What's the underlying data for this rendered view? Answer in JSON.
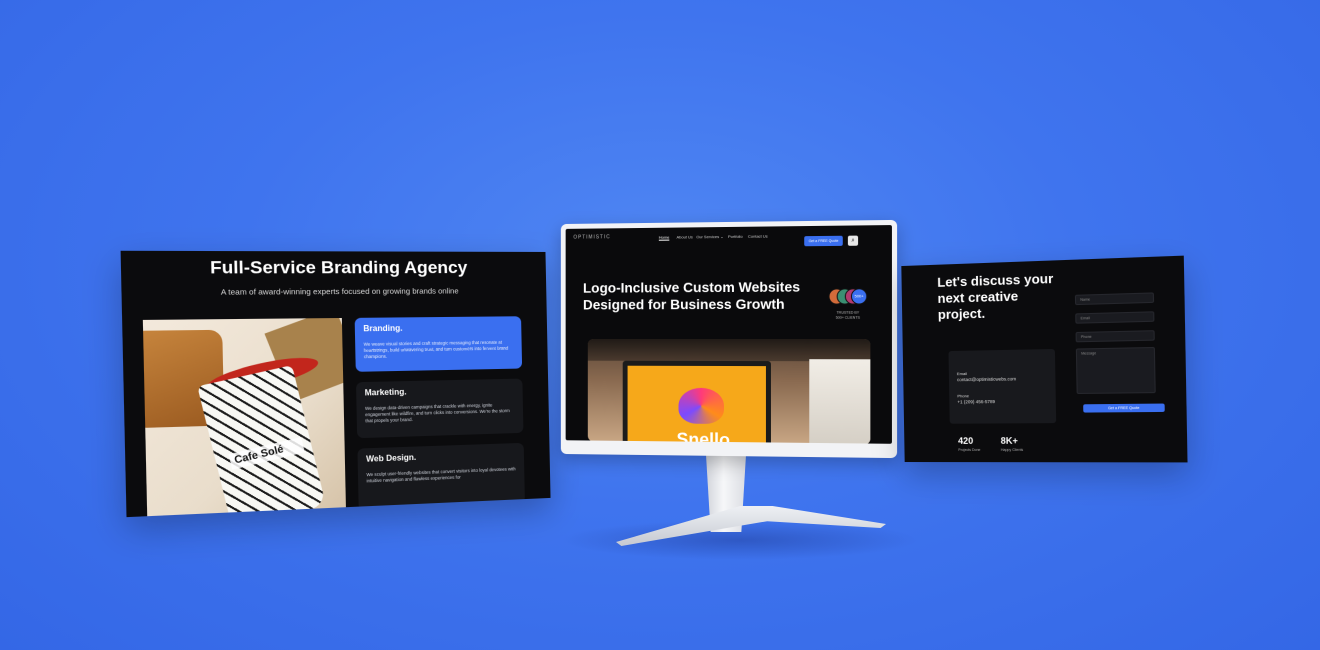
{
  "left_panel": {
    "title": "Full-Service Branding Agency",
    "subtitle": "A team of award-winning experts focused on growing brands online",
    "image_label": "Cafe Solé",
    "services": [
      {
        "title": "Branding.",
        "text": "We weave visual stories and craft strategic messaging that resonate at heartstrings, build unwavering trust, and turn customers into fervent brand champions."
      },
      {
        "title": "Marketing.",
        "text": "We design data-driven campaigns that crackle with energy, ignite engagement like wildfire, and turn clicks into conversions. We're the storm that propels your brand."
      },
      {
        "title": "Web Design.",
        "text": "We sculpt user-friendly websites that convert visitors into loyal devotees with intuitive navigation and flawless experiences for"
      }
    ]
  },
  "monitor": {
    "logo": "OPTIMISTIC",
    "nav": [
      "Home",
      "About Us",
      "Our Services ⌄",
      "Portfolio",
      "Contact Us"
    ],
    "cta": "Get a FREE Quote",
    "hero_title": "Logo-Inclusive Custom Websites Designed for Business Growth",
    "trusted": "TRUSTED BY 500+ CLIENTS",
    "avatar_badge": "500+",
    "sign_text": "Snello"
  },
  "right_panel": {
    "title": "Let's discuss your next creative project.",
    "email_label": "Email",
    "email": "contact@optimisticwebs.com",
    "phone_label": "Phone",
    "phone": "+1 (209) 456-5789",
    "stats": [
      {
        "value": "420",
        "label": "Projects Done"
      },
      {
        "value": "8K+",
        "label": "Happy Clients"
      }
    ],
    "fields": [
      "Name",
      "Email",
      "Phone",
      "Message"
    ],
    "submit": "Get a FREE Quote"
  }
}
